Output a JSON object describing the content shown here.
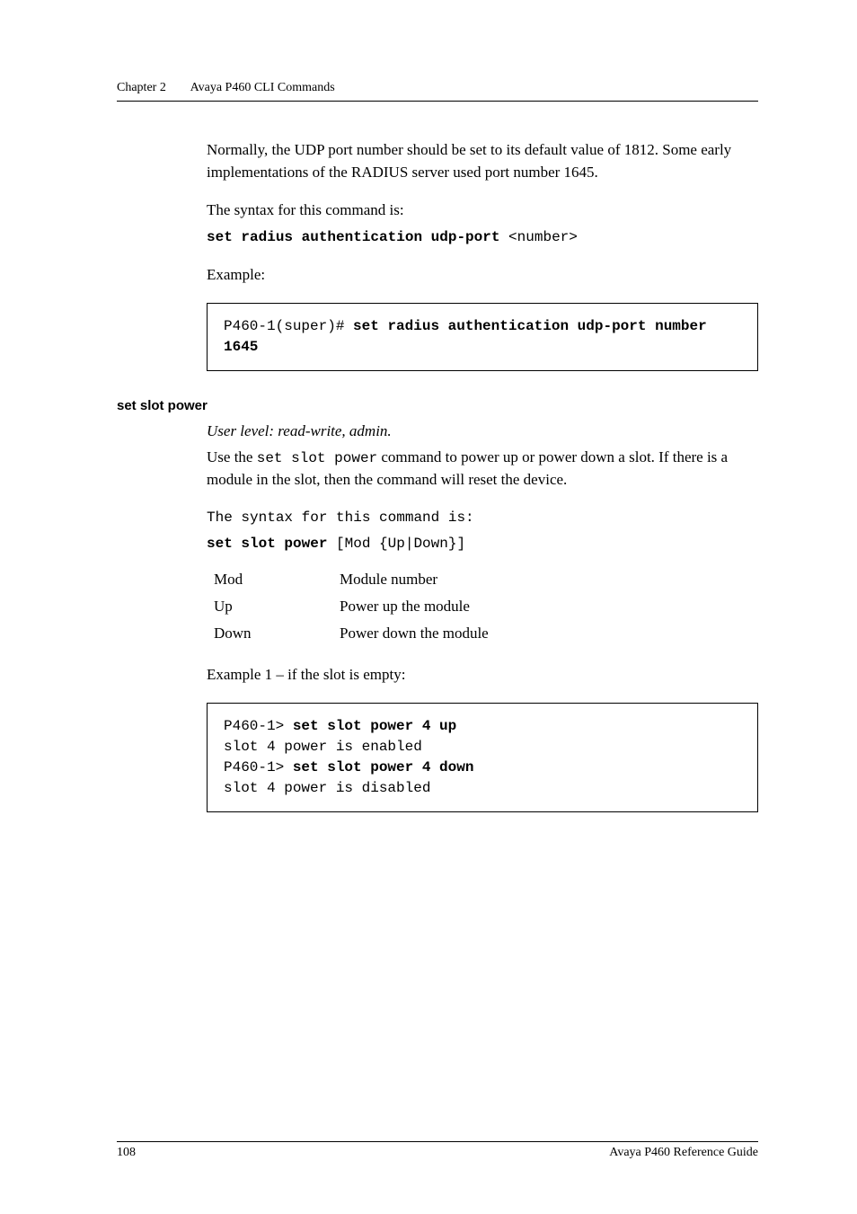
{
  "running_head": {
    "chapter": "Chapter 2",
    "title": "Avaya P460 CLI Commands"
  },
  "intro_paragraph": "Normally, the UDP port number should be set to its default value of 1812. Some early implementations of the RADIUS server used port number 1645.",
  "syntax_lead": "The syntax for this command is:",
  "syntax_cmd_bold": "set radius authentication udp-port",
  "syntax_cmd_arg": " <number>",
  "example_label": "Example:",
  "example1_prompt": "P460-1(super)# ",
  "example1_cmd": "set radius authentication udp-port number 1645",
  "section_heading": "set slot power",
  "user_level": "User level: read-write, admin.",
  "slot_desc_pre": "Use the ",
  "slot_desc_code": "set slot power",
  "slot_desc_post": " command to power up or power down a slot.  If there is a module in the slot, then the command will reset the device.",
  "slot_syntax_lead": "The syntax for this command is:",
  "slot_syntax_bold": "set slot power",
  "slot_syntax_arg": " [Mod {Up|Down}]",
  "params": [
    {
      "name": "Mod",
      "desc": "Module number"
    },
    {
      "name": "Up",
      "desc": "Power up the module"
    },
    {
      "name": "Down",
      "desc": "Power down the module"
    }
  ],
  "example2_label": "Example 1 – if the slot is empty:",
  "example2_lines": [
    {
      "prompt": "P460-1> ",
      "cmd": "set slot power 4 up"
    },
    {
      "output": "slot 4 power is enabled"
    },
    {
      "prompt": "P460-1> ",
      "cmd": "set slot power 4 down"
    },
    {
      "output": "slot 4 power is disabled"
    }
  ],
  "footer": {
    "page_num": "108",
    "guide": "Avaya P460 Reference Guide"
  }
}
